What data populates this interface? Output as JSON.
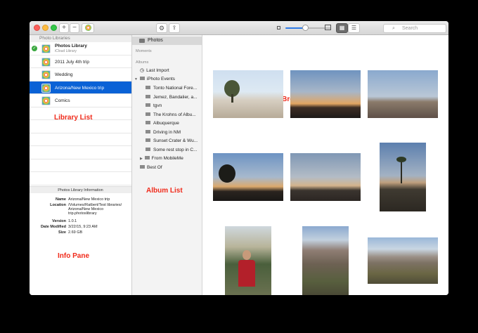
{
  "toolbar": {
    "add_label": "+",
    "remove_label": "−",
    "search_placeholder": "Search"
  },
  "library": {
    "header": "Photo Libraries",
    "items": [
      {
        "label": "Photos Library",
        "sub": "iCloud Library",
        "active": true
      },
      {
        "label": "2011 July 4th trip"
      },
      {
        "label": "Wedding"
      },
      {
        "label": "Arizona/New Mexico trip",
        "selected": true
      },
      {
        "label": "Comics"
      }
    ]
  },
  "info": {
    "header": "Photos Library Information",
    "rows": [
      {
        "k": "Name",
        "v": "Arizona/New Mexico trip"
      },
      {
        "k": "Location",
        "v": "/Volumes/Ratbert/Test libraries/ Arizona/New Mexico trip.photoslibrary"
      },
      {
        "k": "Version",
        "v": "1.0.1"
      },
      {
        "k": "Date Modified",
        "v": "3/22/15, 9:23 AM"
      },
      {
        "k": "Size",
        "v": "2.69 GB"
      }
    ]
  },
  "albums": {
    "photos_label": "Photos",
    "moments_label": "Moments",
    "albums_label": "Albums",
    "last_import": "Last Import",
    "iphoto_events": "iPhoto Events",
    "events": [
      "Tonto National Fore...",
      "Jemez, Bandalier, a...",
      "tgvn",
      "The Krohns of Albu...",
      "Albuquerque",
      "Driving in NM",
      "Sunset Crater & Wu...",
      "Some rest stop in C..."
    ],
    "from_mobileme": "From MobileMe",
    "best_of": "Best Of"
  },
  "annotations": {
    "library_list": "Library List",
    "photo_browser": "Photo Browser",
    "album_list": "Album List",
    "info_pane": "Info Pane"
  },
  "colors": {
    "selection": "#0a62d6",
    "annotation": "#f02a1a",
    "slider_accent": "#2f7be6"
  }
}
